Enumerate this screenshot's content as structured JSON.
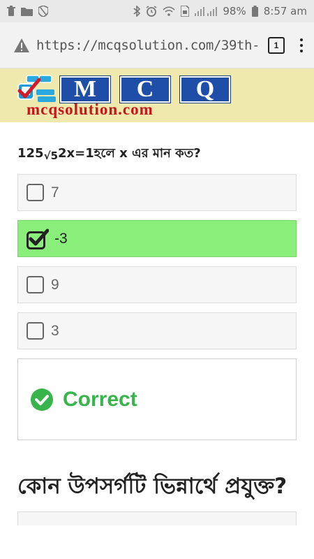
{
  "status_bar": {
    "battery": "98%",
    "time": "8:57 am"
  },
  "browser": {
    "url": "https://mcqsolution.com/39th-",
    "tab_count": "1"
  },
  "site": {
    "logo_letters": [
      "M",
      "C",
      "Q"
    ],
    "domain": "mcqsolution.com"
  },
  "question": {
    "prefix": "125",
    "root": "√5",
    "suffix": "2x=1হলে x এর মান কত?"
  },
  "options": [
    {
      "label": "7",
      "selected": false
    },
    {
      "label": "-3",
      "selected": true
    },
    {
      "label": "9",
      "selected": false
    },
    {
      "label": "3",
      "selected": false
    }
  ],
  "result": {
    "text": "Correct",
    "color": "#37b44a"
  },
  "next_question": {
    "text": "কোন উপসর্গটি ভিন্নার্থে প্রযুক্ত?"
  },
  "colors": {
    "header_bg": "#efe9ae",
    "logo_box": "#1f4ea8",
    "domain_red": "#c8151b",
    "selected_option": "#8aee7a"
  }
}
